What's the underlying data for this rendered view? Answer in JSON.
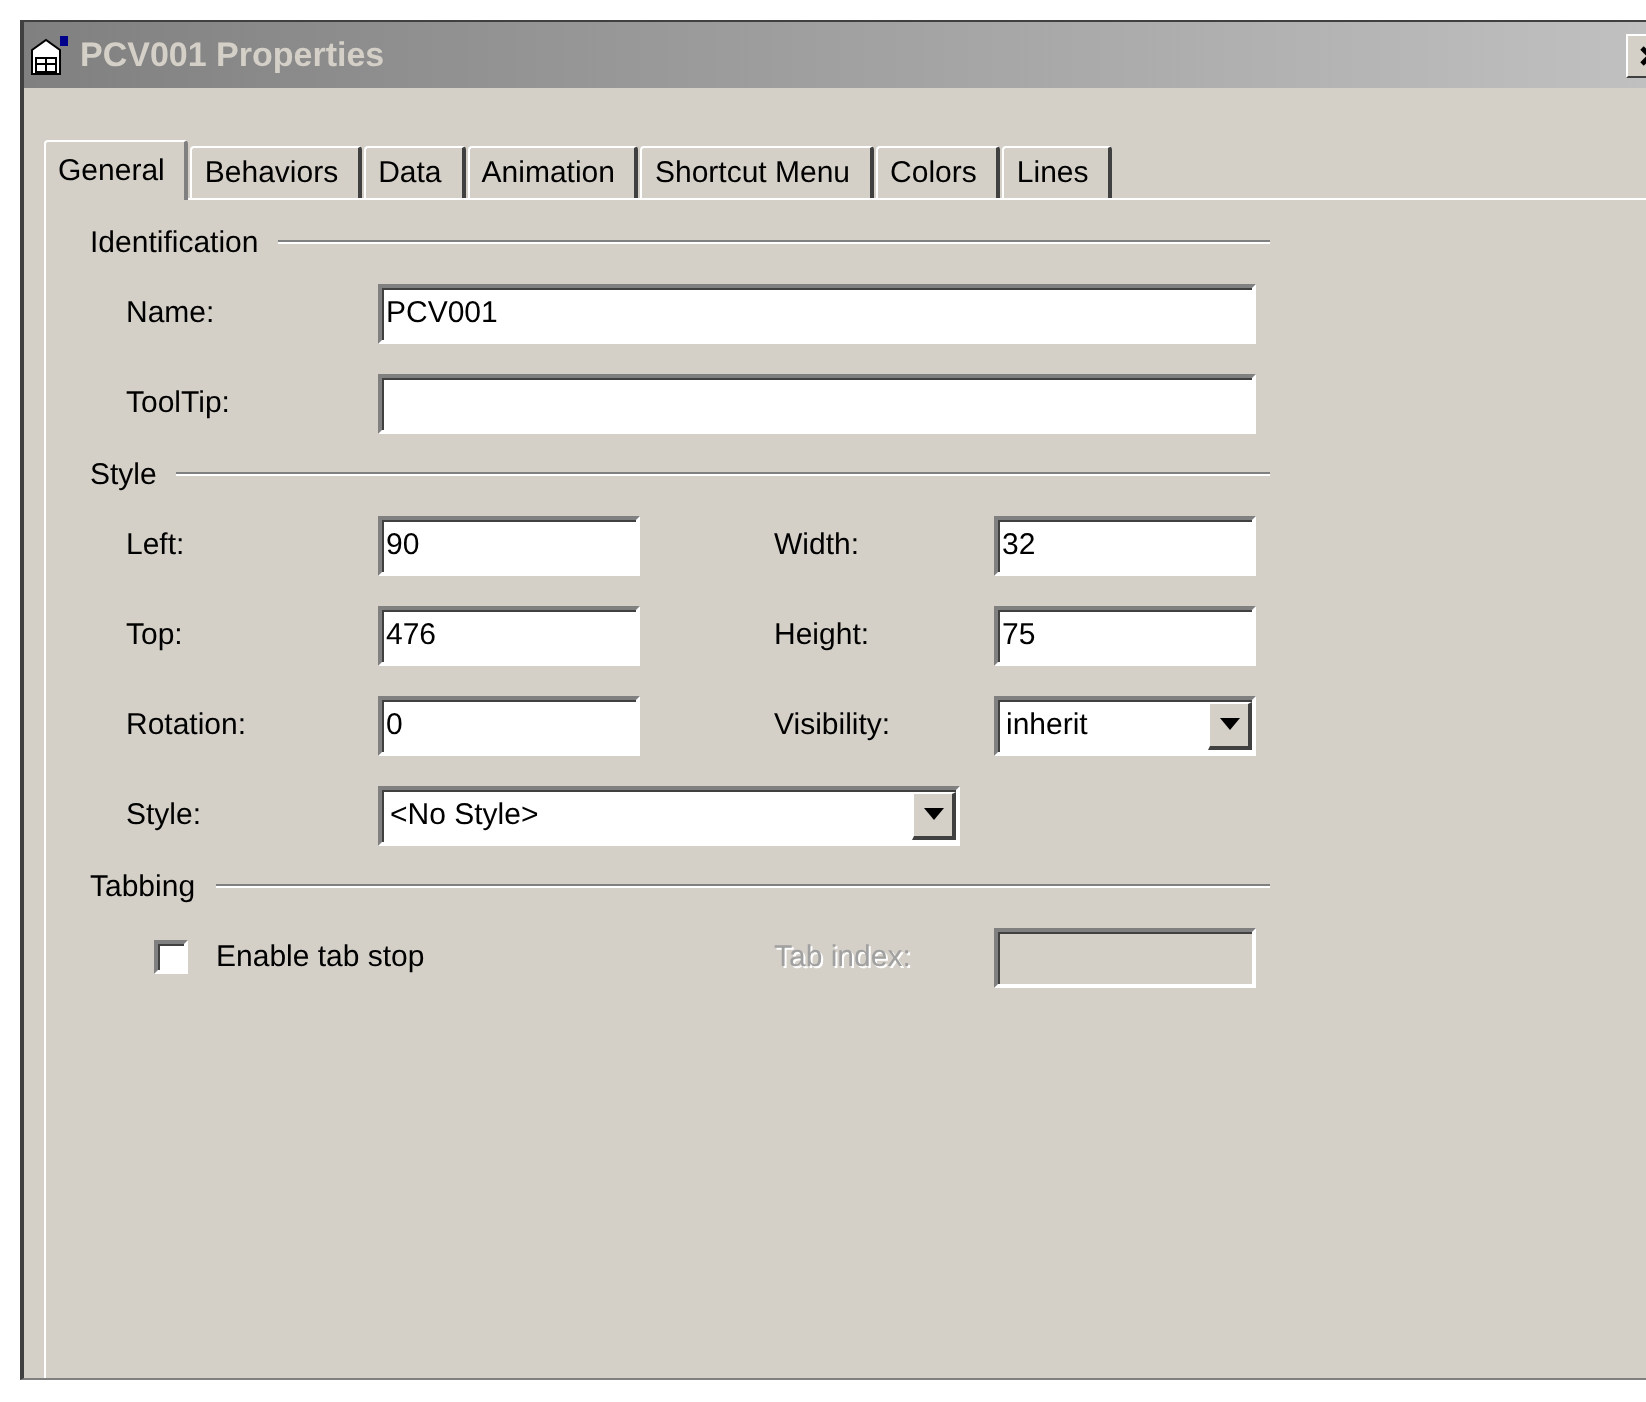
{
  "window": {
    "title": "PCV001 Properties"
  },
  "tabs": [
    {
      "label": "General",
      "selected": true
    },
    {
      "label": "Behaviors",
      "selected": false
    },
    {
      "label": "Data",
      "selected": false
    },
    {
      "label": "Animation",
      "selected": false
    },
    {
      "label": "Shortcut Menu",
      "selected": false
    },
    {
      "label": "Colors",
      "selected": false
    },
    {
      "label": "Lines",
      "selected": false
    }
  ],
  "sections": [
    {
      "title": "Identification",
      "rows": [
        [
          {
            "kind": "text",
            "label": "Name:",
            "value": "PCV001"
          }
        ],
        [
          {
            "kind": "text",
            "label": "ToolTip:"
          }
        ]
      ]
    },
    {
      "title": "Style",
      "rows": [
        [
          {
            "kind": "text",
            "label": "Left:",
            "value": "90"
          },
          {
            "kind": "text",
            "label": "Width:",
            "value": "32"
          }
        ],
        [
          {
            "kind": "text",
            "label": "Top:",
            "value": "476"
          },
          {
            "kind": "text",
            "label": "Height:",
            "value": "75"
          }
        ],
        [
          {
            "kind": "text",
            "label": "Rotation:",
            "value": "0"
          },
          {
            "kind": "combo",
            "label": "Visibility:",
            "value": "inherit"
          }
        ],
        [
          {
            "kind": "combo",
            "label": "Style:",
            "value": "<No Style>"
          }
        ]
      ]
    },
    {
      "title": "Tabbing",
      "rows": [
        [
          {
            "kind": "checkbox",
            "label": "Enable tab stop",
            "checked": false
          },
          {
            "kind": "text",
            "label": "Tab index:",
            "disabled": true
          }
        ]
      ]
    }
  ]
}
